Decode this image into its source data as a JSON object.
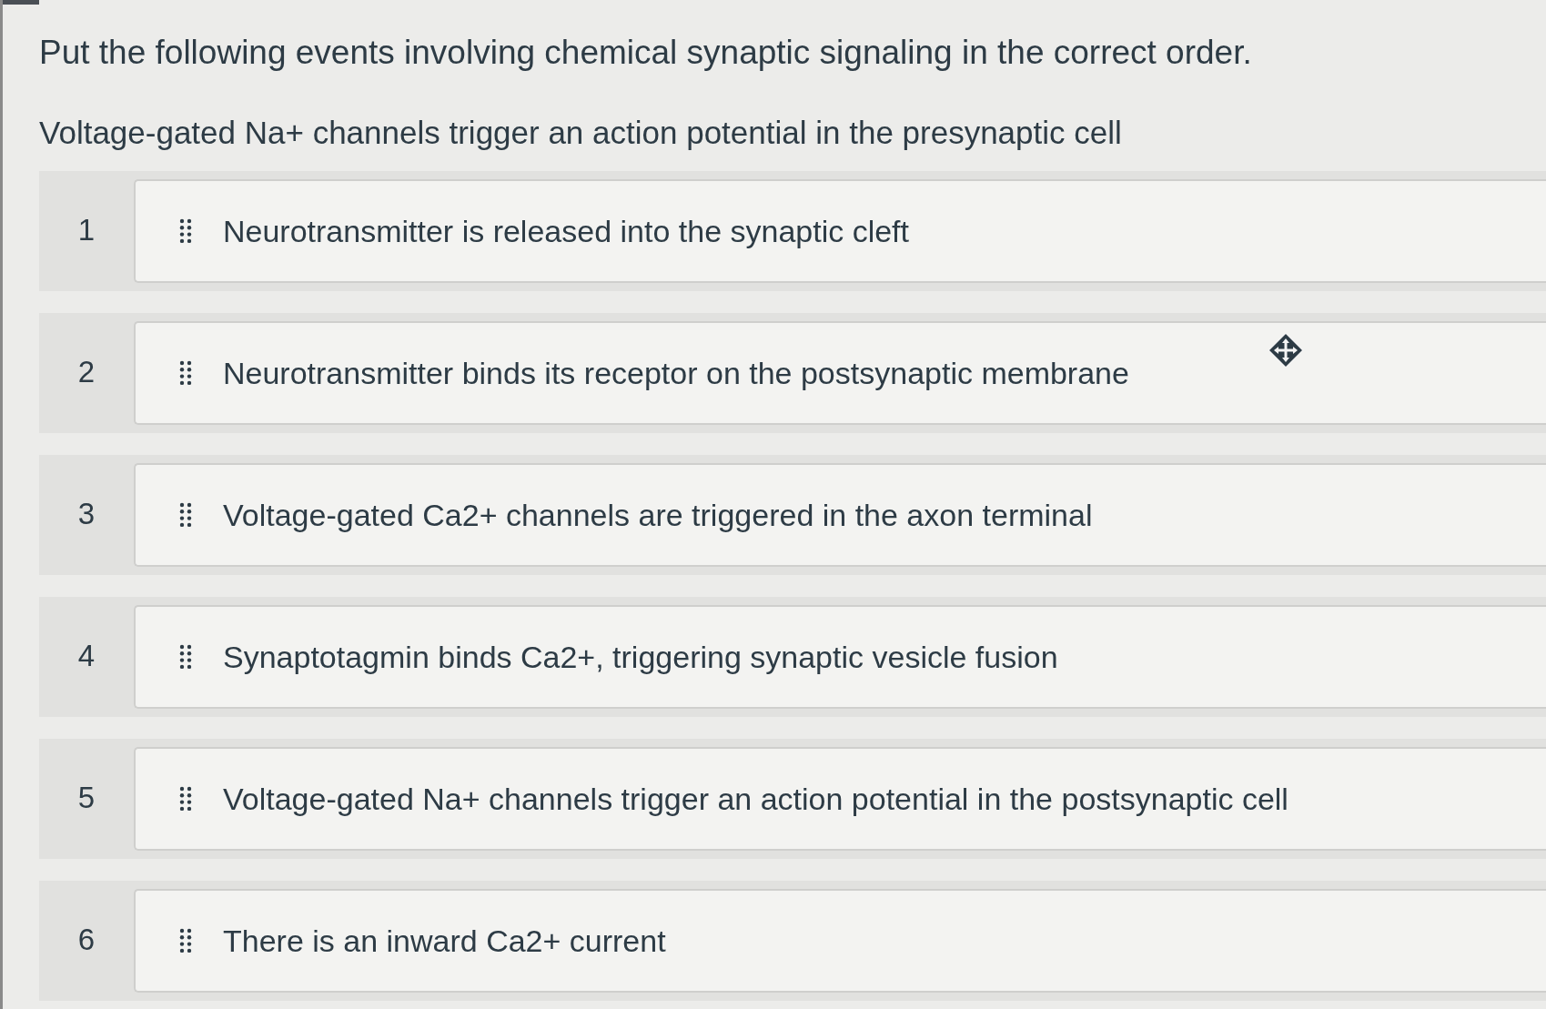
{
  "question": {
    "prompt": "Put the following events involving chemical synaptic signaling in the correct order.",
    "fixed_first": "Voltage-gated Na+ channels trigger an action potential in the presynaptic cell"
  },
  "items": [
    {
      "number": "1",
      "text": "Neurotransmitter is released into the synaptic cleft"
    },
    {
      "number": "2",
      "text": "Neurotransmitter binds its receptor on the postsynaptic membrane"
    },
    {
      "number": "3",
      "text": "Voltage-gated Ca2+ channels are triggered in the axon terminal"
    },
    {
      "number": "4",
      "text": "Synaptotagmin binds Ca2+, triggering synaptic vesicle fusion"
    },
    {
      "number": "5",
      "text": "Voltage-gated Na+ channels trigger an action potential in the postsynaptic cell"
    },
    {
      "number": "6",
      "text": "There is an inward Ca2+ current"
    }
  ]
}
